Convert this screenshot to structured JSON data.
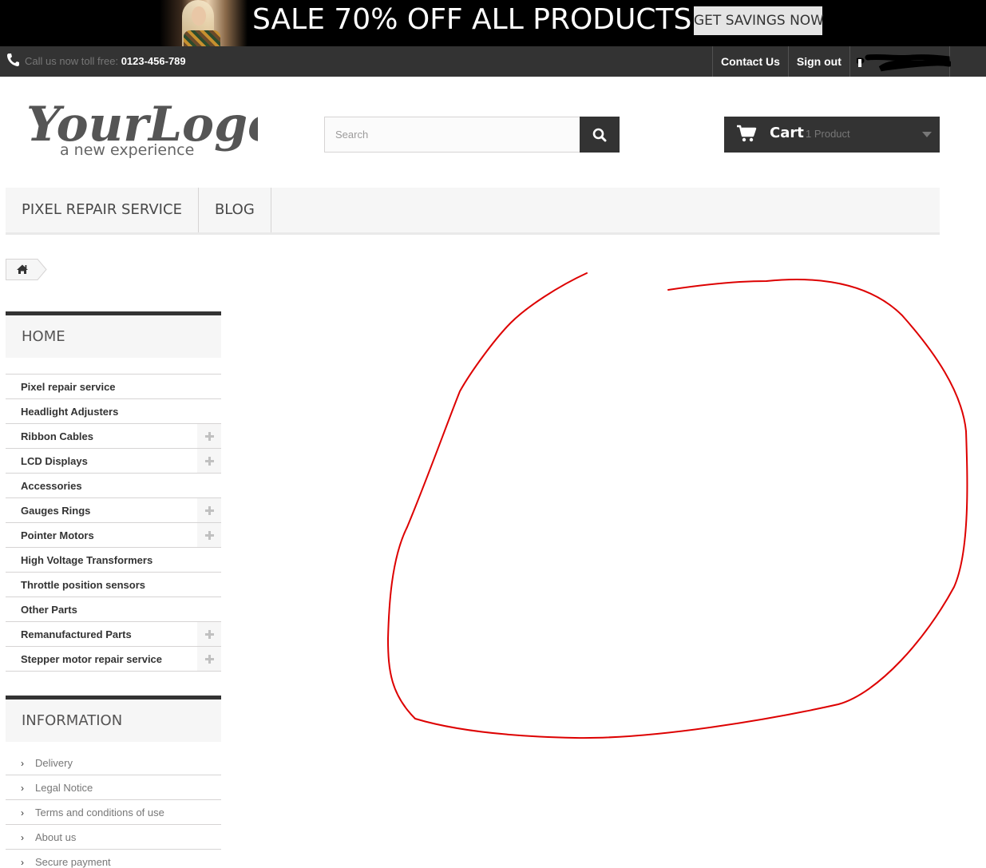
{
  "promo": {
    "headline": "SALE 70% OFF ALL PRODUCTS",
    "button_label": "GET SAVINGS NOW"
  },
  "topbar": {
    "phone_prefix": "Call us now toll free:",
    "phone_number": "0123-456-789",
    "links": {
      "contact": "Contact Us",
      "signout": "Sign out"
    }
  },
  "header": {
    "logo_main": "YourLogo",
    "logo_tagline": "a new experience",
    "search_placeholder": "Search",
    "cart_label": "Cart",
    "cart_quantity": "1 Product"
  },
  "menu": {
    "items": [
      "PIXEL REPAIR SERVICE",
      "BLOG"
    ]
  },
  "sidebar": {
    "categories_title": "HOME",
    "categories": [
      {
        "label": "Pixel repair service",
        "expandable": false
      },
      {
        "label": "Headlight Adjusters",
        "expandable": false
      },
      {
        "label": "Ribbon Cables",
        "expandable": true
      },
      {
        "label": "LCD Displays",
        "expandable": true
      },
      {
        "label": "Accessories",
        "expandable": false
      },
      {
        "label": "Gauges Rings",
        "expandable": true
      },
      {
        "label": "Pointer Motors",
        "expandable": true
      },
      {
        "label": "High Voltage Transformers",
        "expandable": false
      },
      {
        "label": "Throttle position sensors",
        "expandable": false
      },
      {
        "label": "Other Parts",
        "expandable": false
      },
      {
        "label": "Remanufactured Parts",
        "expandable": true
      },
      {
        "label": "Stepper motor repair service",
        "expandable": true
      }
    ],
    "information_title": "INFORMATION",
    "information": [
      "Delivery",
      "Legal Notice",
      "Terms and conditions of use",
      "About us",
      "Secure payment"
    ]
  },
  "colors": {
    "dark": "#333333",
    "light_panel": "#f6f6f6",
    "annotation": "#dd0000"
  },
  "icons": {
    "phone": "phone-icon",
    "search": "search-icon",
    "cart": "cart-icon",
    "home": "home-icon",
    "expand": "plus-icon",
    "chevron": "chevron-right-icon"
  }
}
